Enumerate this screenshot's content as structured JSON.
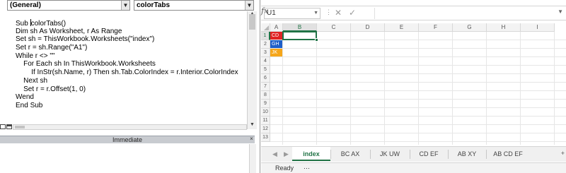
{
  "vbe": {
    "object_combo": "(General)",
    "procedure_combo": "colorTabs",
    "code_lines": [
      [
        "Sub ",
        "colorTabs()"
      ],
      [
        "Dim sh As Worksheet, r As Range"
      ],
      [
        "Set sh = ThisWorkbook.Worksheets(\"index\")"
      ],
      [
        "Set r = sh.Range(\"A1\")"
      ],
      [
        "While r <> \"\""
      ],
      [
        "    For Each sh In ThisWorkbook.Worksheets"
      ],
      [
        "        If InStr(sh.Name, r) Then sh.Tab.ColorIndex = r.Interior.ColorIndex"
      ],
      [
        "    Next sh"
      ],
      [
        "    Set r = r.Offset(1, 0)"
      ],
      [
        "Wend"
      ],
      [
        "End Sub"
      ]
    ],
    "immediate_title": "Immediate",
    "immediate_close": "×"
  },
  "excel": {
    "name_box": "U1",
    "formula": "",
    "fx": "fx",
    "columns": [
      "A",
      "B",
      "C",
      "D",
      "E",
      "F",
      "G",
      "H",
      "I"
    ],
    "rows": [
      "1",
      "2",
      "3",
      "4",
      "5",
      "6",
      "7",
      "8",
      "9",
      "10",
      "11",
      "12",
      "13"
    ],
    "cells": [
      {
        "ref": "A1",
        "value": "CD",
        "fill": "#e02424"
      },
      {
        "ref": "A2",
        "value": "GH",
        "fill": "#1f5fc8"
      },
      {
        "ref": "A3",
        "value": "JK",
        "fill": "#f5a61a"
      }
    ],
    "active_cell": "B1",
    "sheet_tabs": [
      {
        "label": "index",
        "active": true,
        "color": ""
      },
      {
        "label": "BC AX",
        "active": false,
        "color": ""
      },
      {
        "label": "JK UW",
        "active": false,
        "color": ""
      },
      {
        "label": "CD EF",
        "active": false,
        "color": ""
      },
      {
        "label": "AB XY",
        "active": false,
        "color": ""
      },
      {
        "label": "AB CD EF",
        "active": false,
        "color": ""
      }
    ],
    "tab_more": "+",
    "status": "Ready",
    "accent_color": "#217346"
  }
}
